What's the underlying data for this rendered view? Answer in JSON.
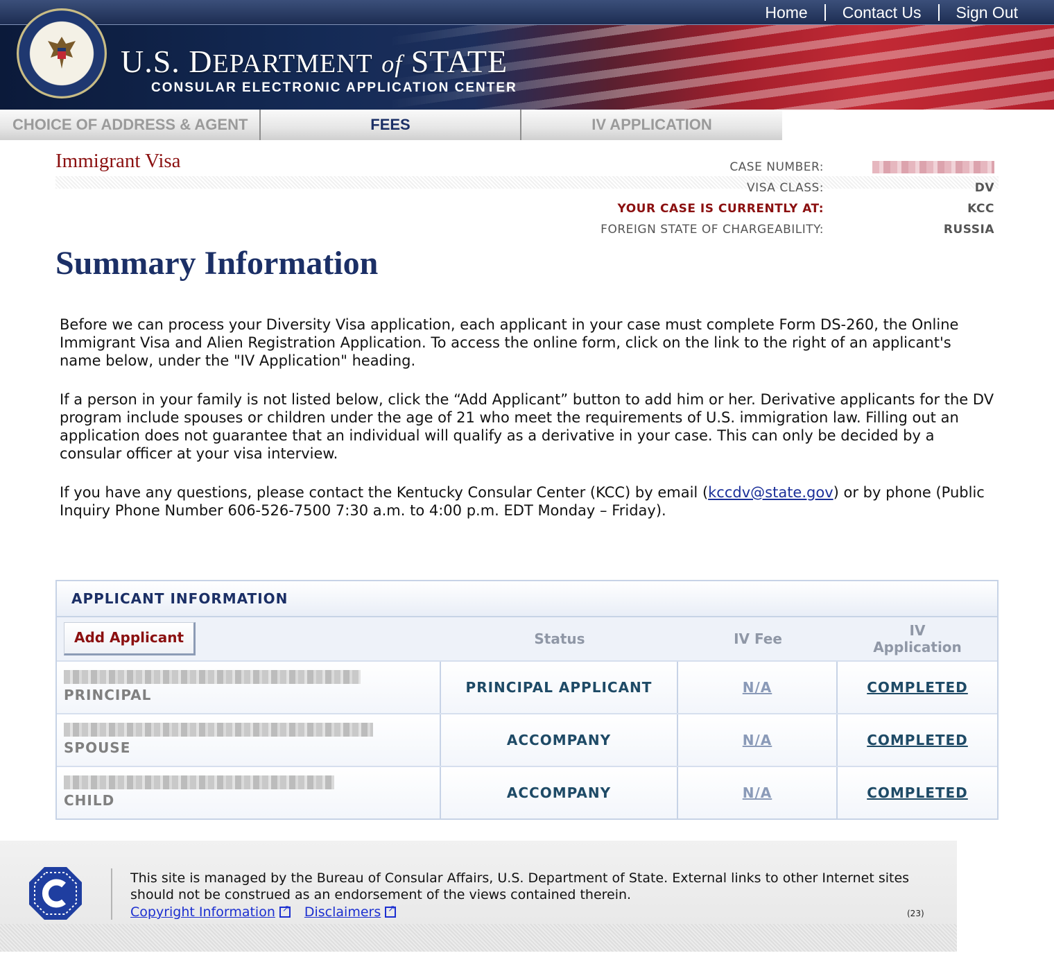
{
  "header": {
    "nav": [
      "Home",
      "Contact Us",
      "Sign Out"
    ],
    "title_pre": "U.S. D",
    "title_main": "EPARTMENT",
    "title_of": "of",
    "title_state": "STATE",
    "subtitle": "CONSULAR ELECTRONIC APPLICATION CENTER"
  },
  "tabs": [
    {
      "label": "CHOICE OF ADDRESS & AGENT",
      "active": false
    },
    {
      "label": "FEES",
      "active": true
    },
    {
      "label": "IV APPLICATION",
      "active": false
    }
  ],
  "case": {
    "page_title": "Immigrant Visa",
    "rows": [
      {
        "label": "CASE NUMBER:",
        "value": ""
      },
      {
        "label": "VISA CLASS:",
        "value": "DV"
      },
      {
        "label": "YOUR CASE IS CURRENTLY AT:",
        "value": "KCC"
      },
      {
        "label": "FOREIGN STATE OF CHARGEABILITY:",
        "value": "RUSSIA"
      }
    ]
  },
  "summary": {
    "title": "Summary Information",
    "p1": "Before we can process your Diversity Visa application, each applicant in your case must complete Form DS-260, the Online Immigrant Visa and Alien Registration Application. To access the online form, click on the link to the right of an applicant's name below, under the \"IV Application\" heading.",
    "p2": "If a person in your family is not listed below, click the “Add Applicant” button to add him or her. Derivative applicants for the DV program include spouses or children under the age of 21 who meet the requirements of U.S. immigration law. Filling out an application does not guarantee that an individual will qualify as a derivative in your case. This can only be decided by a consular officer at your visa interview.",
    "p3_before": "If you have any questions, please contact the Kentucky Consular Center (KCC) by email (",
    "p3_email": "kccdv@state.gov",
    "p3_after": ") or by phone (Public Inquiry Phone Number 606-526-7500 7:30 a.m. to 4:00 p.m. EDT Monday – Friday)."
  },
  "applicants": {
    "heading": "APPLICANT INFORMATION",
    "add_button": "Add Applicant",
    "col_status": "Status",
    "col_fee": "IV Fee",
    "col_app_line1": "IV",
    "col_app_line2": "Application",
    "rows": [
      {
        "role": "PRINCIPAL",
        "status": "PRINCIPAL APPLICANT",
        "fee": "N/A",
        "application": "COMPLETED"
      },
      {
        "role": "SPOUSE",
        "status": "ACCOMPANY",
        "fee": "N/A",
        "application": "COMPLETED"
      },
      {
        "role": "CHILD",
        "status": "ACCOMPANY",
        "fee": "N/A",
        "application": "COMPLETED"
      }
    ]
  },
  "footer": {
    "text": "This site is managed by the Bureau of Consular Affairs, U.S. Department of State. External links to other Internet sites should not be construed as an endorsement of the views contained therein.",
    "links": [
      "Copyright Information",
      "Disclaimers"
    ],
    "page_number": "(23)"
  },
  "colors": {
    "navy": "#1b2f66",
    "maroon": "#8b1010",
    "teal": "#1e4a66"
  }
}
